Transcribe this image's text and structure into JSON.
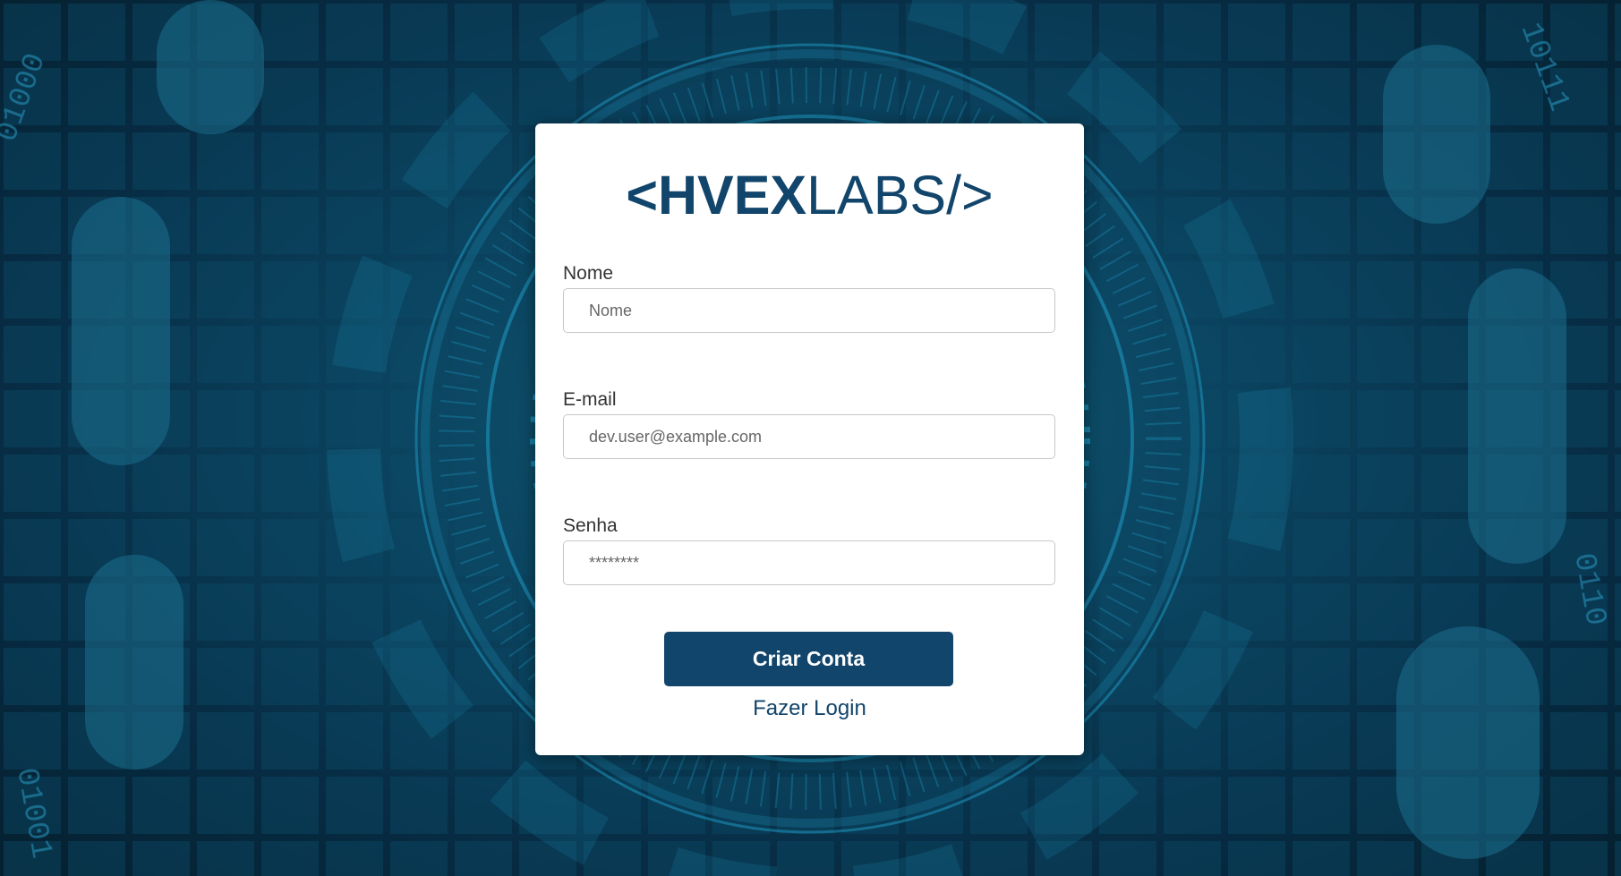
{
  "brand": {
    "prefix": "<",
    "bold": "HVEX",
    "light": "LABS/>"
  },
  "form": {
    "name": {
      "label": "Nome",
      "placeholder": "Nome"
    },
    "email": {
      "label": "E-mail",
      "placeholder": "dev.user@example.com"
    },
    "password": {
      "label": "Senha",
      "placeholder": "********"
    },
    "submit_label": "Criar Conta",
    "login_link": "Fazer Login"
  },
  "colors": {
    "primary": "#12456b",
    "background_dark": "#072c44",
    "background_accent": "#1b8fb5"
  }
}
